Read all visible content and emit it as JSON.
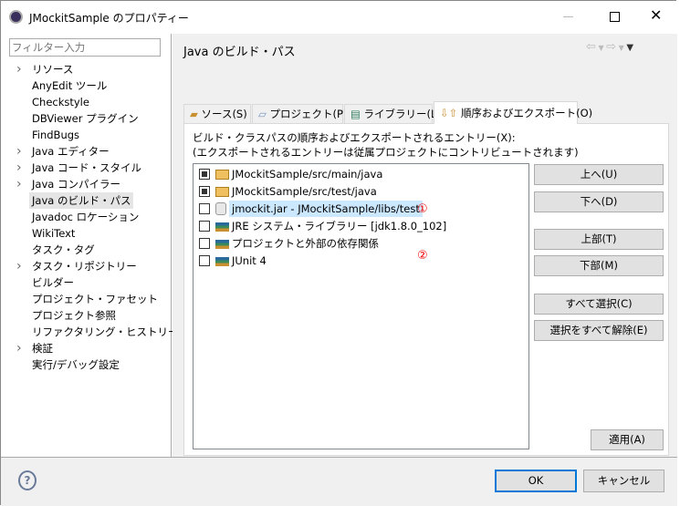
{
  "window": {
    "title": "JMockitSample のプロパティー"
  },
  "sidebar": {
    "filter_placeholder": "フィルター入力",
    "items": [
      {
        "label": "リソース",
        "expandable": true
      },
      {
        "label": "AnyEdit ツール",
        "expandable": false
      },
      {
        "label": "Checkstyle",
        "expandable": false
      },
      {
        "label": "DBViewer プラグイン",
        "expandable": false
      },
      {
        "label": "FindBugs",
        "expandable": false
      },
      {
        "label": "Java エディター",
        "expandable": true
      },
      {
        "label": "Java コード・スタイル",
        "expandable": true
      },
      {
        "label": "Java コンパイラー",
        "expandable": true
      },
      {
        "label": "Java のビルド・パス",
        "expandable": false,
        "selected": true
      },
      {
        "label": "Javadoc ロケーション",
        "expandable": false
      },
      {
        "label": "WikiText",
        "expandable": false
      },
      {
        "label": "タスク・タグ",
        "expandable": false
      },
      {
        "label": "タスク・リポジトリー",
        "expandable": true
      },
      {
        "label": "ビルダー",
        "expandable": false
      },
      {
        "label": "プロジェクト・ファセット",
        "expandable": false
      },
      {
        "label": "プロジェクト参照",
        "expandable": false
      },
      {
        "label": "リファクタリング・ヒストリー",
        "expandable": false
      },
      {
        "label": "検証",
        "expandable": true
      },
      {
        "label": "実行/デバッグ設定",
        "expandable": false
      }
    ]
  },
  "page": {
    "title": "Java のビルド・パス",
    "tabs": [
      "ソース(S)",
      "プロジェクト(P)",
      "ライブラリー(L)",
      "順序およびエクスポート(O)"
    ],
    "description1": "ビルド・クラスパスの順序およびエクスポートされるエントリー(X):",
    "description2": "(エクスポートされるエントリーは従属プロジェクトにコントリビュートされます)",
    "entries": [
      {
        "label": "JMockitSample/src/main/java",
        "checked": true,
        "icon": "source-folder-icon"
      },
      {
        "label": "JMockitSample/src/test/java",
        "checked": true,
        "icon": "source-folder-icon"
      },
      {
        "label": "jmockit.jar - JMockitSample/libs/test",
        "checked": false,
        "icon": "jar-icon",
        "selected": true
      },
      {
        "label": "JRE システム・ライブラリー [jdk1.8.0_102]",
        "checked": false,
        "icon": "library-icon"
      },
      {
        "label": "プロジェクトと外部の依存関係",
        "checked": false,
        "icon": "library-icon"
      },
      {
        "label": "JUnit 4",
        "checked": false,
        "icon": "library-icon"
      }
    ],
    "markers": [
      "①",
      "②"
    ],
    "buttons": {
      "up": "上へ(U)",
      "down": "下へ(D)",
      "top": "上部(T)",
      "bottom": "下部(M)",
      "select_all": "すべて選択(C)",
      "deselect_all": "選択をすべて解除(E)"
    },
    "apply": "適用(A)"
  },
  "footer": {
    "ok": "OK",
    "cancel": "キャンセル",
    "help": "?"
  }
}
